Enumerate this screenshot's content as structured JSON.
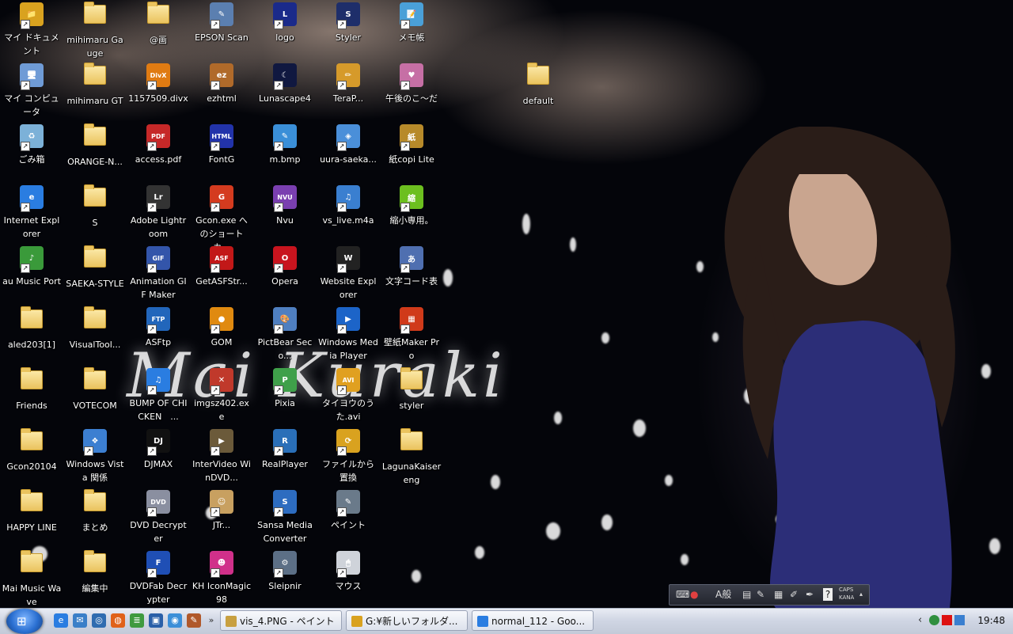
{
  "wallpaper": {
    "title": "Mai Kuraki"
  },
  "desktop_icons": [
    {
      "label": "マイ ドキュメント",
      "kind": "app",
      "color": "#d9a21f",
      "glyph": "📁"
    },
    {
      "label": "マイ コンピュータ",
      "kind": "app",
      "color": "#6f9bd6",
      "glyph": "🖥"
    },
    {
      "label": "ごみ箱",
      "kind": "app",
      "color": "#7cb1d8",
      "glyph": "♻"
    },
    {
      "label": "Internet Explorer",
      "kind": "app",
      "color": "#2a7de1",
      "glyph": "e"
    },
    {
      "label": "au Music Port",
      "kind": "app",
      "color": "#3a9a3a",
      "glyph": "♪"
    },
    {
      "label": "aled203[1]",
      "kind": "folder"
    },
    {
      "label": "Friends",
      "kind": "folder"
    },
    {
      "label": "Gcon20104",
      "kind": "folder"
    },
    {
      "label": "HAPPY LINE",
      "kind": "folder"
    },
    {
      "label": "Mai Music Wave",
      "kind": "folder"
    },
    {
      "label": "mihimaru Gauge",
      "kind": "folder"
    },
    {
      "label": "mihimaru GT",
      "kind": "folder"
    },
    {
      "label": "ORANGE-N...",
      "kind": "folder"
    },
    {
      "label": "S",
      "kind": "folder"
    },
    {
      "label": "SAEKA-STYLE",
      "kind": "folder"
    },
    {
      "label": "VisualTool...",
      "kind": "folder"
    },
    {
      "label": "VOTECOM",
      "kind": "folder"
    },
    {
      "label": "Windows Vista 関係",
      "kind": "app",
      "color": "#3c7fd1",
      "glyph": "❖"
    },
    {
      "label": "まとめ",
      "kind": "folder"
    },
    {
      "label": "編集中",
      "kind": "folder"
    },
    {
      "label": "@画",
      "kind": "folder"
    },
    {
      "label": "1157509.divx",
      "kind": "app",
      "color": "#e07b12",
      "glyph": "DivX"
    },
    {
      "label": "access.pdf",
      "kind": "app",
      "color": "#c62828",
      "glyph": "PDF"
    },
    {
      "label": "Adobe Lightroom",
      "kind": "app",
      "color": "#333333",
      "glyph": "Lr"
    },
    {
      "label": "Animation GIF Maker",
      "kind": "app",
      "color": "#3355aa",
      "glyph": "GIF"
    },
    {
      "label": "ASFtp",
      "kind": "app",
      "color": "#2266bb",
      "glyph": "FTP"
    },
    {
      "label": "BUMP OF CHICKEN　...",
      "kind": "app",
      "color": "#2a7de1",
      "glyph": "♫"
    },
    {
      "label": "DJMAX",
      "kind": "app",
      "color": "#111111",
      "glyph": "DJ"
    },
    {
      "label": "DVD Decrypter",
      "kind": "app",
      "color": "#8a8fa0",
      "glyph": "DVD"
    },
    {
      "label": "DVDFab Decrypter",
      "kind": "app",
      "color": "#1f4fb5",
      "glyph": "F"
    },
    {
      "label": "EPSON Scan",
      "kind": "app",
      "color": "#5b7fb0",
      "glyph": "✎"
    },
    {
      "label": "ezhtml",
      "kind": "app",
      "color": "#b06a2a",
      "glyph": "ez"
    },
    {
      "label": "FontG",
      "kind": "app",
      "color": "#2233aa",
      "glyph": "HTML"
    },
    {
      "label": "Gcon.exe へのショートカ...",
      "kind": "app",
      "color": "#d43b1f",
      "glyph": "G"
    },
    {
      "label": "GetASFStr...",
      "kind": "app",
      "color": "#c21818",
      "glyph": "ASF"
    },
    {
      "label": "GOM",
      "kind": "app",
      "color": "#e08a10",
      "glyph": "●"
    },
    {
      "label": "imgsz402.exe",
      "kind": "app",
      "color": "#c0392b",
      "glyph": "✕"
    },
    {
      "label": "InterVideo WinDVD...",
      "kind": "app",
      "color": "#6b5a3a",
      "glyph": "▶"
    },
    {
      "label": "JTr...",
      "kind": "app",
      "color": "#c8a060",
      "glyph": "☺"
    },
    {
      "label": "KH IconMagic98",
      "kind": "app",
      "color": "#d0308a",
      "glyph": "☻"
    },
    {
      "label": "logo",
      "kind": "app",
      "color": "#1a2a8a",
      "glyph": "L"
    },
    {
      "label": "Lunascape4",
      "kind": "app",
      "color": "#101840",
      "glyph": "☾"
    },
    {
      "label": "m.bmp",
      "kind": "app",
      "color": "#3a8fd8",
      "glyph": "✎"
    },
    {
      "label": "Nvu",
      "kind": "app",
      "color": "#7a3fb0",
      "glyph": "NVU"
    },
    {
      "label": "Opera",
      "kind": "app",
      "color": "#c8141e",
      "glyph": "O"
    },
    {
      "label": "PictBear Seco...",
      "kind": "app",
      "color": "#4f7fc0",
      "glyph": "🎨"
    },
    {
      "label": "Pixia",
      "kind": "app",
      "color": "#3fa04a",
      "glyph": "P"
    },
    {
      "label": "RealPlayer",
      "kind": "app",
      "color": "#2a6fb8",
      "glyph": "R"
    },
    {
      "label": "Sansa Media Converter",
      "kind": "app",
      "color": "#2d6cc0",
      "glyph": "S"
    },
    {
      "label": "Sleipnir",
      "kind": "app",
      "color": "#5c6f86",
      "glyph": "⚙"
    },
    {
      "label": "Styler",
      "kind": "app",
      "color": "#1e2e6a",
      "glyph": "S"
    },
    {
      "label": "TeraP...",
      "kind": "app",
      "color": "#d69a2a",
      "glyph": "✏"
    },
    {
      "label": "uura-saeka...",
      "kind": "app",
      "color": "#4a8fd9",
      "glyph": "◈"
    },
    {
      "label": "vs_live.m4a",
      "kind": "app",
      "color": "#3a7fd0",
      "glyph": "♫"
    },
    {
      "label": "Website Explorer",
      "kind": "app",
      "color": "#222222",
      "glyph": "W"
    },
    {
      "label": "Windows Media Player",
      "kind": "app",
      "color": "#1c64c8",
      "glyph": "▶"
    },
    {
      "label": "タイヨウのうた.avi",
      "kind": "app",
      "color": "#e0a020",
      "glyph": "AVI"
    },
    {
      "label": "ファイルから置換",
      "kind": "app",
      "color": "#d9a21f",
      "glyph": "⟳"
    },
    {
      "label": "ペイント",
      "kind": "app",
      "color": "#6a7a8a",
      "glyph": "✎"
    },
    {
      "label": "マウス",
      "kind": "app",
      "color": "#cfd3da",
      "glyph": "🖱"
    },
    {
      "label": "メモ帳",
      "kind": "app",
      "color": "#4aa0d8",
      "glyph": "📝"
    },
    {
      "label": "午後のこ〜だ",
      "kind": "app",
      "color": "#c66fa5",
      "glyph": "♥"
    },
    {
      "label": "紙copi Lite",
      "kind": "app",
      "color": "#b78a2a",
      "glyph": "紙"
    },
    {
      "label": "縮小専用。",
      "kind": "app",
      "color": "#6cbf1f",
      "glyph": "縮"
    },
    {
      "label": "文字コード表",
      "kind": "app",
      "color": "#4f6fb0",
      "glyph": "あ"
    },
    {
      "label": "壁紙Maker Pro",
      "kind": "app",
      "color": "#d03a1a",
      "glyph": "▦"
    },
    {
      "label": "styler",
      "kind": "folder"
    },
    {
      "label": "LagunaKaiser eng",
      "kind": "folder"
    },
    {
      "label": "default",
      "kind": "folder"
    }
  ],
  "langbar": {
    "mode": "A般",
    "caps": "CAPS",
    "kana": "KANA"
  },
  "taskbar": {
    "start_glyph": "⊞",
    "quicklaunch": [
      {
        "name": "ie-icon",
        "glyph": "e",
        "color": "#2a7de1"
      },
      {
        "name": "mail-icon",
        "glyph": "✉",
        "color": "#3a7fc8"
      },
      {
        "name": "outlook-icon",
        "glyph": "◎",
        "color": "#2f6cb0"
      },
      {
        "name": "firefox-icon",
        "glyph": "◍",
        "color": "#e0621a"
      },
      {
        "name": "ftp-icon",
        "glyph": "≣",
        "color": "#3f9a3f"
      },
      {
        "name": "office-icon",
        "glyph": "▣",
        "color": "#2a5fa8"
      },
      {
        "name": "world-icon",
        "glyph": "◉",
        "color": "#3c8fd8"
      },
      {
        "name": "paint-icon",
        "glyph": "✎",
        "color": "#b0582a"
      }
    ],
    "overflow": "»",
    "tasks": [
      {
        "label": "vis_4.PNG - ペイント",
        "color": "#c8a040"
      },
      {
        "label": "G:¥新しいフォルダ...",
        "color": "#d9a21f"
      },
      {
        "label": "normal_112 - Goo...",
        "color": "#2a7de1"
      }
    ],
    "tray_chevron": "‹",
    "clock": "19:48"
  }
}
